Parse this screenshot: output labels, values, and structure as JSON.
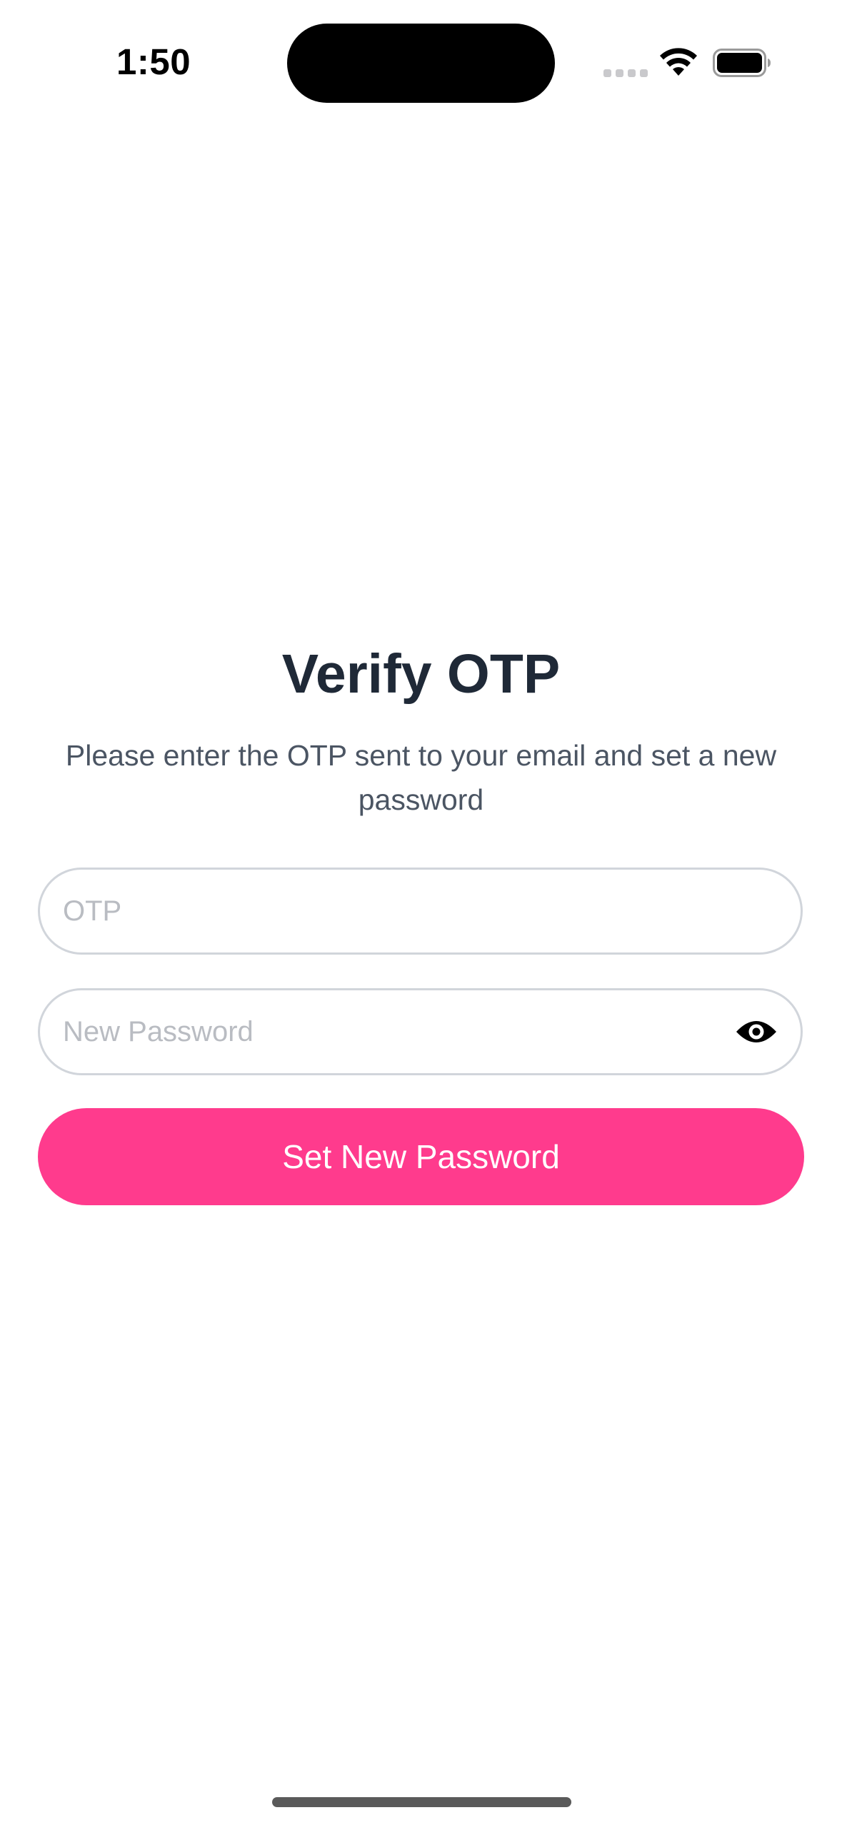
{
  "status_bar": {
    "time": "1:50"
  },
  "verify": {
    "title": "Verify OTP",
    "subtitle": "Please enter the OTP sent to your email and set a new password",
    "otp_placeholder": "OTP",
    "otp_value": "",
    "password_placeholder": "New Password",
    "password_value": "",
    "submit_label": "Set New Password"
  },
  "colors": {
    "accent": "#ff3b8d",
    "title_text": "#1f2937",
    "body_text": "#4b5563",
    "field_border": "#d1d5db",
    "placeholder": "#b9bcc2"
  },
  "icons": {
    "wifi": "wifi-icon",
    "battery": "battery-icon",
    "signal": "cellular-signal-icon",
    "password_toggle": "eye-icon"
  }
}
